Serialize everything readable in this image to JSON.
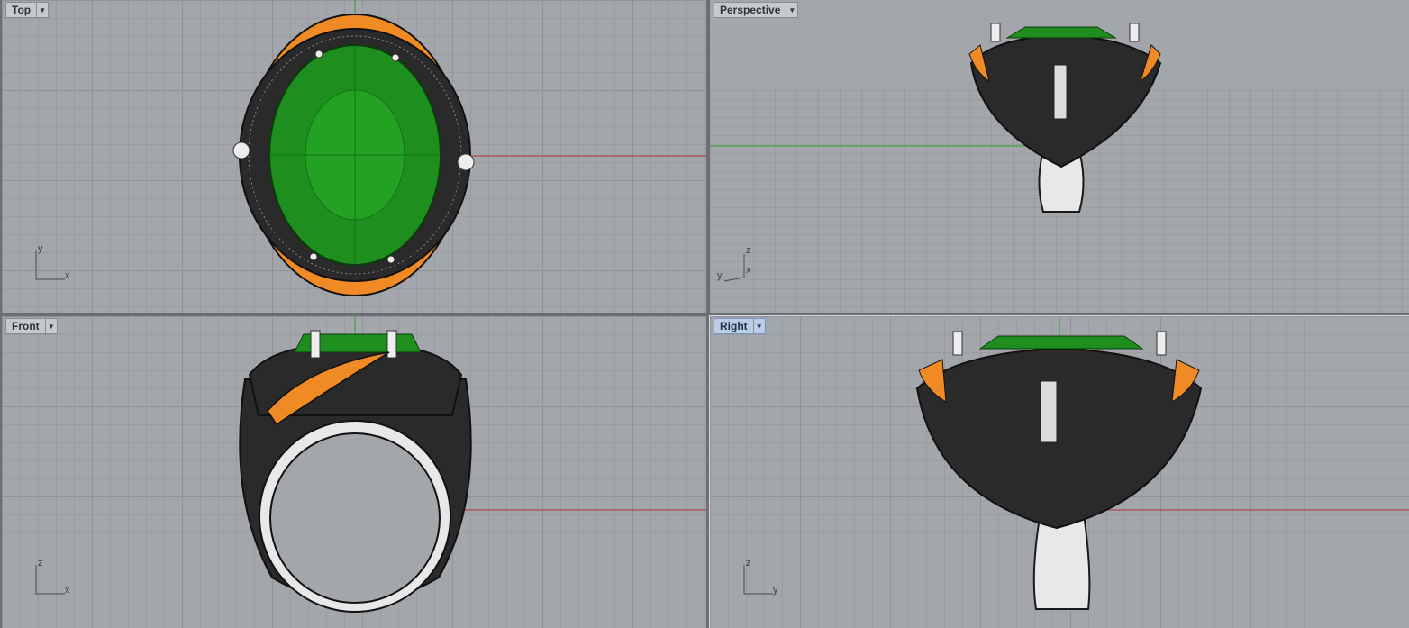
{
  "colors": {
    "viewport_bg": "#a3a7ac",
    "gem": "#1e8f1e",
    "gold_accent": "#f08a24",
    "x_axis": "#b03030",
    "y_axis": "#2aa02a",
    "wire": "#1a1a1a"
  },
  "viewports": {
    "top": {
      "label": "Top",
      "axis_h": "x",
      "axis_v": "y",
      "active": false
    },
    "perspective": {
      "label": "Perspective",
      "axis_h": "x",
      "axis_v": "z",
      "axis_d": "y",
      "active": false
    },
    "front": {
      "label": "Front",
      "axis_h": "x",
      "axis_v": "z",
      "active": false
    },
    "right": {
      "label": "Right",
      "axis_h": "y",
      "axis_v": "z",
      "active": true
    }
  },
  "icons": {
    "menu": "chevron-down-icon"
  }
}
